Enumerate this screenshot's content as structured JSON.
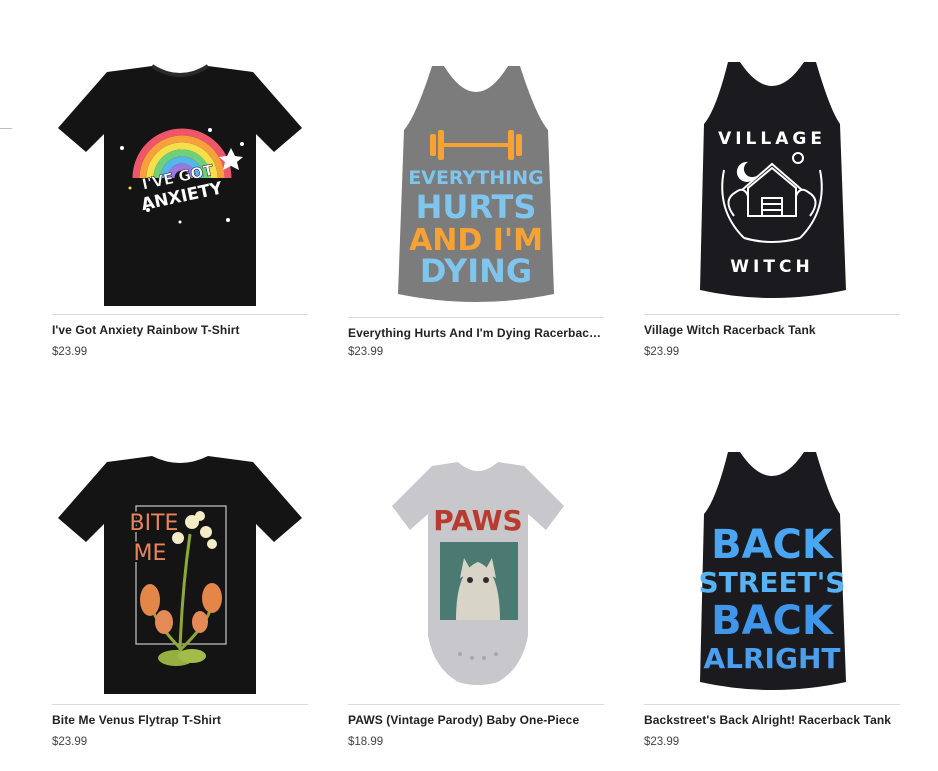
{
  "products": [
    {
      "title": "I've Got Anxiety Rainbow T-Shirt",
      "price": "$23.99",
      "design": {
        "line1": "I'VE GOT",
        "line2": "ANXIETY"
      }
    },
    {
      "title": "Everything Hurts And I'm Dying Racerback Tank",
      "price": "$23.99",
      "design": {
        "lines": [
          "EVERYTHING",
          "HURTS",
          "AND I'M",
          "DYING"
        ]
      }
    },
    {
      "title": "Village Witch Racerback Tank",
      "price": "$23.99",
      "design": {
        "top": "VILLAGE",
        "bottom": "WITCH"
      }
    },
    {
      "title": "Bite Me Venus Flytrap T-Shirt",
      "price": "$23.99",
      "design": {
        "line1": "BITE",
        "line2": "ME"
      }
    },
    {
      "title": "PAWS (Vintage Parody) Baby One-Piece",
      "price": "$18.99",
      "design": {
        "headline": "PAWS"
      }
    },
    {
      "title": "Backstreet's Back Alright! Racerback Tank",
      "price": "$23.99",
      "design": {
        "lines": [
          "BACK",
          "STREET'S",
          "BACK",
          "ALRIGHT"
        ]
      }
    }
  ]
}
